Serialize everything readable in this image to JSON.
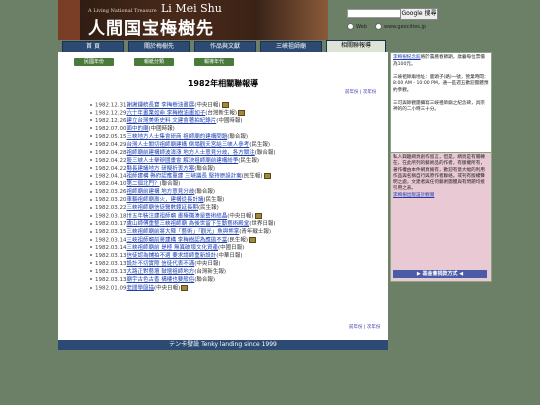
{
  "banner": {
    "subtitle": "A Living National Treasure",
    "name_en": "Li Mei Shu",
    "name_zh": "人間国宝梅樹先"
  },
  "search": {
    "button_label": "Google 搜尋",
    "option_web": "Web",
    "option_site": "www.geocities.jp"
  },
  "nav": {
    "tabs": [
      "首  頁",
      "關於梅樹先",
      "作品與文獻",
      "三峽祖師廟",
      "相關聯報導"
    ]
  },
  "subnav": [
    "民國年份",
    "報紙分類",
    "報導年代"
  ],
  "page_title": "1982年相關聯報導",
  "links": {
    "top": "前年份 | 次年份",
    "bottom": "前年份 | 次年份"
  },
  "articles": [
    {
      "date": "1982.12.31",
      "title": "謝謝鍾統長寶 李梅樹油畫展",
      "source": "(中央日報)",
      "cam": true
    },
    {
      "date": "1982.12.29",
      "title": "六十年畫業如命 李梅樹油畫如子",
      "source": "(台灣新生報)",
      "cam": true
    },
    {
      "date": "1982.12.26",
      "title": "建立台灣美術史料 文建會著拍紀錄片",
      "source": "(中國時報)",
      "cam": false
    },
    {
      "date": "1982.07.00",
      "title": "面中的廟",
      "source": "(中國時報)",
      "cam": false
    },
    {
      "date": "1982.05.15",
      "title": "三峽地方人士集會研商 祖師廟的建構問題",
      "source": "(聯合報)",
      "cam": false
    },
    {
      "date": "1982.04.29",
      "title": "台灣人士關切祖師廟建構 倒塌觀天宮給三峽人參考",
      "source": "(民生報)",
      "cam": false
    },
    {
      "date": "1982.04.28",
      "title": "祖師廟前建構師波濤漲 地方人士意見分歧，各方關注",
      "source": "(聯合報)",
      "cam": false
    },
    {
      "date": "1982.04.22",
      "title": "股三峽人士舉辦國畫會 解決祖師廟前建構紛爭",
      "source": "(民生報)",
      "cam": false
    },
    {
      "date": "1982.04.22",
      "title": "縣長建議地方 研擬折衷方案",
      "source": "(聯合報)",
      "cam": false
    },
    {
      "date": "1982.04.14",
      "title": "祖師建構 縣府認應重建 三峽議長 堅持原設計案",
      "source": "(民生報)",
      "cam": true
    },
    {
      "date": "1982.04.10",
      "title": "第二個北門？",
      "source": "(聯合報)",
      "cam": false
    },
    {
      "date": "1982.03.26",
      "title": "祖師廟前建構 地方意見分歧",
      "source": "(聯合報)",
      "cam": false
    },
    {
      "date": "1982.03.20",
      "title": "車輛祖師廟壽火，建構從長計議",
      "source": "(民生報)",
      "cam": false
    },
    {
      "date": "1982.03.22",
      "title": "三峽祖師廟信徒醫數鐘延長期",
      "source": "(民生報)",
      "cam": false
    },
    {
      "date": "1982.03.18",
      "title": "卅五年裝注建祖師廟 畫檯攤湊是藝術結晶",
      "source": "(中央日報)",
      "cam": true
    },
    {
      "date": "1982.03.17",
      "title": "盧山師傅重整三峽祖師廟 為後世留下生動藝術殿堂",
      "source": "(世界日報)",
      "cam": false
    },
    {
      "date": "1982.03.15",
      "title": "三峽祖師廟前將大陣「藝術」「觀光」魚與熊掌",
      "source": "(青年戰士報)",
      "cam": false
    },
    {
      "date": "1982.03.14",
      "title": "三峽祖師廟前將建構 李梅樹認為應拋不當",
      "source": "(民生報)",
      "cam": true
    },
    {
      "date": "1982.03.14",
      "title": "三峽祖師廟前 是極 無異破壞文化資產",
      "source": "(中國日報)",
      "cam": false
    },
    {
      "date": "1982.03.13",
      "title": "信徒認為鋪拍不適 要求請師重新設計",
      "source": "(中華日報)",
      "cam": false
    },
    {
      "date": "1982.03.13",
      "title": "設計不切實際 信徒代表不滿",
      "source": "(中央日報)",
      "cam": false
    },
    {
      "date": "1982.03.13",
      "title": "大路正對藝壇 鼓壇祖師地方",
      "source": "(台灣新生報)",
      "cam": false
    },
    {
      "date": "1982.03.13",
      "title": "廟宇古色古香 構樓也要般俗",
      "source": "(聯合報)",
      "cam": false
    },
    {
      "date": "1982.01.09",
      "title": "老間學殷描",
      "source": "(中央日報)",
      "cam": true
    }
  ],
  "footer": {
    "left": "テン卡發設",
    "right": "Tenky landing since 1999"
  },
  "sidebar": {
    "box1_link": "李梅樹紀念館",
    "box1_text": "將於農曆春節期，歲暮每位票價為100元。",
    "box1_text2": "三峽祖師廟地址：鹿頭子(路)一號，營業時間：8:00 AM - 10:00 PM，通一區週五歡迎團體預約參觀。",
    "box1_text3": "三可與師觀團攝寫三峽祖師廟之紀念碑，具宗神的的二小時三十分。",
    "box2_text": "私人興趣網頁創作留言，但是，網頁是有關轉在，在此所列的藝術品的作者，有版權所有，著作權由本件網頁擁有，歡迎有意大幅的利用作品與名稱自行與原作者聯絡。或刊有版權聲明之處，文建者與任何藝術團體與有問題均接引用之表。",
    "box2_link": "李梅樹出版設計觀賞",
    "box2_header": "▶ 基金會捐款方式 ◀"
  }
}
